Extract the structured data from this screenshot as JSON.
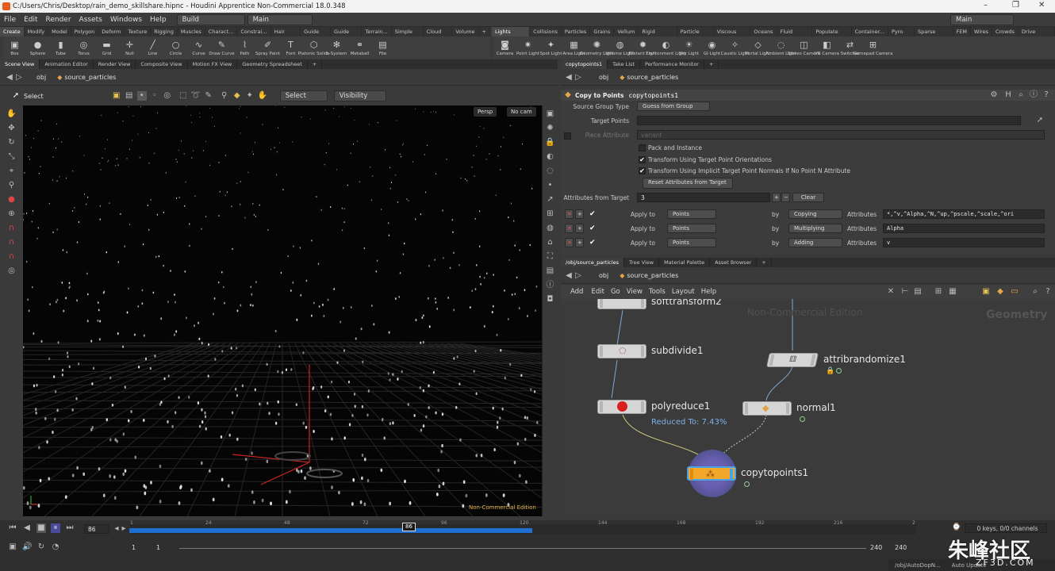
{
  "titlebar": {
    "title": "C:/Users/Chris/Desktop/rain_demo_skillshare.hipnc - Houdini Apprentice Non-Commercial 18.0.348",
    "minimize": "–",
    "maximize": "❐",
    "close": "✕"
  },
  "menubar": {
    "items": [
      "File",
      "Edit",
      "Render",
      "Assets",
      "Windows",
      "Help"
    ],
    "desktop": "Build",
    "context": "Main",
    "right_desktop": "Main"
  },
  "shelf_left": {
    "tabs": [
      "Create",
      "Modify",
      "Model",
      "Polygon",
      "Deform",
      "Texture",
      "Rigging",
      "Muscles",
      "Charact...",
      "Constrai...",
      "Hair Utils",
      "Guide P...",
      "Guide B...",
      "Terrain...",
      "Simple FX",
      "Cloud FX",
      "Volume"
    ],
    "tools": [
      {
        "label": "Box",
        "icon": "▣"
      },
      {
        "label": "Sphere",
        "icon": "●"
      },
      {
        "label": "Tube",
        "icon": "▮"
      },
      {
        "label": "Torus",
        "icon": "◎"
      },
      {
        "label": "Grid",
        "icon": "▬"
      },
      {
        "label": "Null",
        "icon": "✛"
      },
      {
        "label": "Line",
        "icon": "╱"
      },
      {
        "label": "Circle",
        "icon": "○"
      },
      {
        "label": "Curve",
        "icon": "∿"
      },
      {
        "label": "Draw Curve",
        "icon": "✎"
      },
      {
        "label": "Path",
        "icon": "⌇"
      },
      {
        "label": "Spray Paint",
        "icon": "✐"
      },
      {
        "label": "Font",
        "icon": "T"
      },
      {
        "label": "Platonic Solids",
        "icon": "⬡"
      },
      {
        "label": "L-System",
        "icon": "✻"
      },
      {
        "label": "Metaball",
        "icon": "⚭"
      },
      {
        "label": "File",
        "icon": "▤"
      }
    ]
  },
  "shelf_right": {
    "tabs": [
      "Lights and...",
      "Collisions",
      "Particles",
      "Grains",
      "Vellum",
      "Rigid Bodies",
      "Particle Fl...",
      "Viscous Fl...",
      "Oceans",
      "Fluid Con...",
      "Populate C...",
      "Container...",
      "Pyro FX",
      "Sparse Pyr...",
      "FEM",
      "Wires",
      "Crowds",
      "Drive Sim..."
    ],
    "tools": [
      {
        "label": "Camera",
        "icon": "◙"
      },
      {
        "label": "Point Light",
        "icon": "✷"
      },
      {
        "label": "Spot Light",
        "icon": "✦"
      },
      {
        "label": "Area Light",
        "icon": "▦"
      },
      {
        "label": "Geometry Light",
        "icon": "✺"
      },
      {
        "label": "Volume Light",
        "icon": "◍"
      },
      {
        "label": "Distant Light",
        "icon": "✹"
      },
      {
        "label": "Environment Light",
        "icon": "◐"
      },
      {
        "label": "Sky Light",
        "icon": "☀"
      },
      {
        "label": "GI Light",
        "icon": "◉"
      },
      {
        "label": "Caustic Light",
        "icon": "✧"
      },
      {
        "label": "Portal Light",
        "icon": "◇"
      },
      {
        "label": "Ambient Light",
        "icon": "◌"
      },
      {
        "label": "Stereo Camera",
        "icon": "◫"
      },
      {
        "label": "VR Camera",
        "icon": "◧"
      },
      {
        "label": "Switcher",
        "icon": "⇄"
      },
      {
        "label": "Gamepad Camera",
        "icon": "⊞"
      }
    ]
  },
  "left_pane": {
    "tabs": [
      "Scene View",
      "Animation Editor",
      "Render View",
      "Composite View",
      "Motion FX View",
      "Geometry Spreadsheet"
    ],
    "path": [
      "obj",
      "source_particles"
    ],
    "select_label": "Select",
    "select_mode": "Select",
    "visibility": "Visibility",
    "persp": "Persp",
    "cam": "No cam",
    "watermark": "Non-Commercial Edition"
  },
  "params": {
    "tabs": [
      "copytopoints1",
      "Take List",
      "Performance Monitor"
    ],
    "path": [
      "obj",
      "source_particles"
    ],
    "node_type": "Copy to Points",
    "node_name": "copytopoints1",
    "source_group_type_label": "Source Group Type",
    "source_group_type": "Guess from Group",
    "target_points_label": "Target Points",
    "piece_attr_label": "Piece Attribute",
    "piece_attr": "variant",
    "pack_instance": "Pack and Instance",
    "transform_orient": "Transform Using Target Point Orientations",
    "transform_normals": "Transform Using Implicit Target Point Normals If No Point N Attribute",
    "reset_btn": "Reset Attributes from Target",
    "attrs_from_target_label": "Attributes from Target",
    "attrs_count": "3",
    "clear": "Clear",
    "rows": [
      {
        "apply": "Apply to",
        "to": "Points",
        "by": "by",
        "mode": "Copying",
        "attrs_label": "Attributes",
        "attrs": "*,^v,^Alpha,^N,^up,^pscale,^scale,^ori"
      },
      {
        "apply": "Apply to",
        "to": "Points",
        "by": "by",
        "mode": "Multiplying",
        "attrs_label": "Attributes",
        "attrs": "Alpha"
      },
      {
        "apply": "Apply to",
        "to": "Points",
        "by": "by",
        "mode": "Adding",
        "attrs_label": "Attributes",
        "attrs": "v"
      }
    ]
  },
  "network": {
    "tabs": [
      "/obj/source_particles",
      "Tree View",
      "Material Palette",
      "Asset Browser"
    ],
    "path": [
      "obj",
      "source_particles"
    ],
    "menu": [
      "Add",
      "Edit",
      "Go",
      "View",
      "Tools",
      "Layout",
      "Help"
    ],
    "watermark": "Non-Commercial Edition",
    "context": "Geometry",
    "nodes": {
      "softtransform": "softtransform2",
      "subdivide": "subdivide1",
      "polyreduce": "polyreduce1",
      "reduced": "Reduced To: 7.43%",
      "attribrandomize": "attribrandomize1",
      "normal": "normal1",
      "copytopoints": "copytopoints1"
    }
  },
  "timeline": {
    "frame": "86",
    "current_marker": "86",
    "ticks": [
      "1",
      "24",
      "48",
      "72",
      "96",
      "120",
      "144",
      "168",
      "192",
      "216",
      "2"
    ],
    "start": "1",
    "start2": "1",
    "end": "240",
    "end2": "240",
    "keys": "0 keys, 0/0 channels",
    "key_all": "Key All Channels"
  },
  "status": {
    "path": "/obj/AutoDopN...",
    "update": "Auto Update"
  },
  "brand": {
    "logo": "朱峰社区",
    "site": "ZF3D.COM"
  }
}
